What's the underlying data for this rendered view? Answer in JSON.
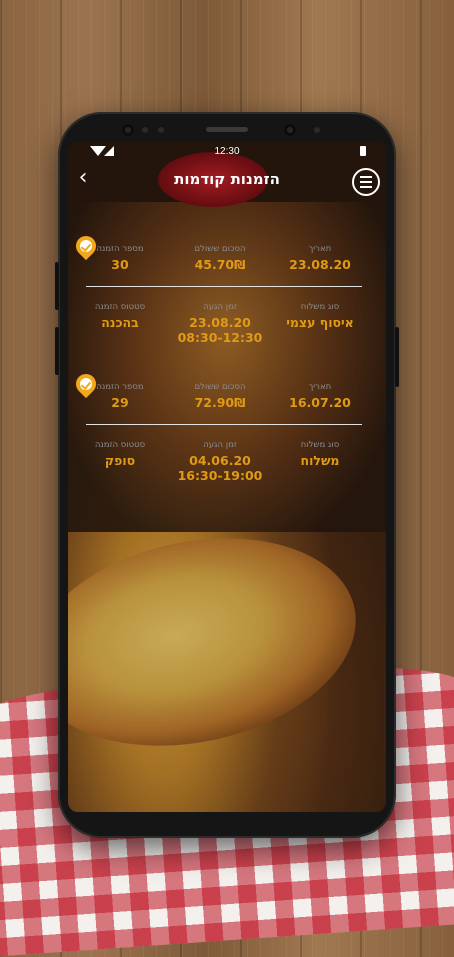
{
  "status_bar": {
    "time": "12:30"
  },
  "header": {
    "title": "הזמנות קודמות",
    "back_glyph": "‹"
  },
  "labels": {
    "date": "תאריך",
    "amount_paid": "הסכום ששולם",
    "order_number": "מספר הזמנה",
    "delivery_type": "סוג משלוח",
    "arrival_time": "זמן הגעה",
    "order_status": "סטטוס הזמנה"
  },
  "orders": [
    {
      "date": "23.08.20",
      "amount": "45.70₪",
      "order_number": "30",
      "delivery_type": "איסוף עצמי",
      "arrival_date": "23.08.20",
      "arrival_window": "08:30-12:30",
      "status": "בהכנה"
    },
    {
      "date": "16.07.20",
      "amount": "72.90₪",
      "order_number": "29",
      "delivery_type": "משלוח",
      "arrival_date": "04.06.20",
      "arrival_window": "16:30-19:00",
      "status": "סופק"
    }
  ],
  "colors": {
    "accent": "#e09a16",
    "label": "#8c8c8c",
    "card": "#ffffff"
  },
  "icons": [
    "back-icon",
    "menu-icon",
    "order-check-icon",
    "wifi-icon",
    "signal-icon",
    "battery-icon"
  ]
}
